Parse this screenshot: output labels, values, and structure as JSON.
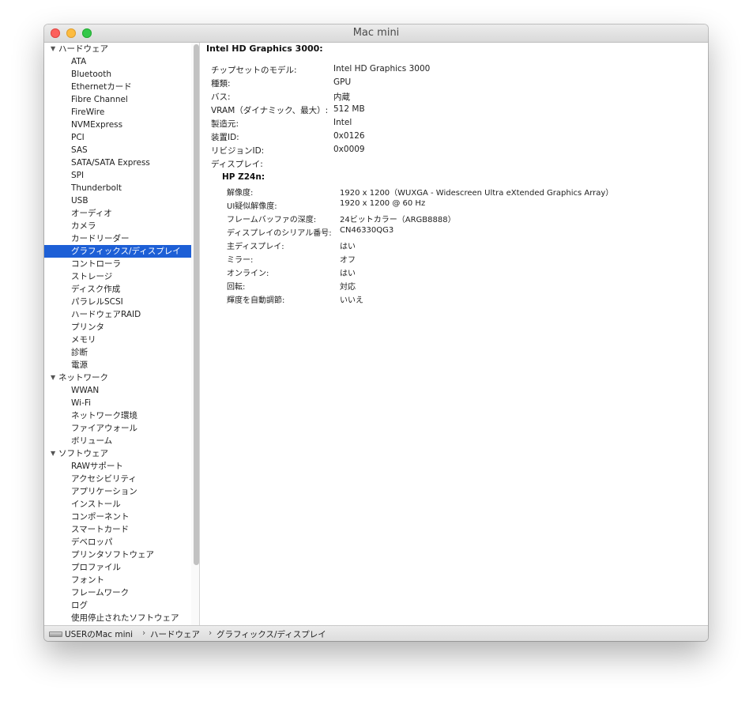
{
  "window": {
    "title": "Mac mini"
  },
  "sidebar": {
    "items": [
      {
        "label": "ハードウェア",
        "group": true
      },
      {
        "label": "ATA"
      },
      {
        "label": "Bluetooth"
      },
      {
        "label": "Ethernetカード"
      },
      {
        "label": "Fibre Channel"
      },
      {
        "label": "FireWire"
      },
      {
        "label": "NVMExpress"
      },
      {
        "label": "PCI"
      },
      {
        "label": "SAS"
      },
      {
        "label": "SATA/SATA Express"
      },
      {
        "label": "SPI"
      },
      {
        "label": "Thunderbolt"
      },
      {
        "label": "USB"
      },
      {
        "label": "オーディオ"
      },
      {
        "label": "カメラ"
      },
      {
        "label": "カードリーダー"
      },
      {
        "label": "グラフィックス/ディスプレイ",
        "selected": true
      },
      {
        "label": "コントローラ"
      },
      {
        "label": "ストレージ"
      },
      {
        "label": "ディスク作成"
      },
      {
        "label": "パラレルSCSI"
      },
      {
        "label": "ハードウェアRAID"
      },
      {
        "label": "プリンタ"
      },
      {
        "label": "メモリ"
      },
      {
        "label": "診断"
      },
      {
        "label": "電源"
      },
      {
        "label": "ネットワーク",
        "group": true
      },
      {
        "label": "WWAN"
      },
      {
        "label": "Wi-Fi"
      },
      {
        "label": "ネットワーク環境"
      },
      {
        "label": "ファイアウォール"
      },
      {
        "label": "ボリューム"
      },
      {
        "label": "ソフトウェア",
        "group": true
      },
      {
        "label": "RAWサポート"
      },
      {
        "label": "アクセシビリティ"
      },
      {
        "label": "アプリケーション"
      },
      {
        "label": "インストール"
      },
      {
        "label": "コンポーネント"
      },
      {
        "label": "スマートカード"
      },
      {
        "label": "デベロッパ"
      },
      {
        "label": "プリンタソフトウェア"
      },
      {
        "label": "プロファイル"
      },
      {
        "label": "フォント"
      },
      {
        "label": "フレームワーク"
      },
      {
        "label": "ログ"
      },
      {
        "label": "使用停止されたソフトウェア"
      }
    ]
  },
  "detail": {
    "heading": "Intel HD Graphics 3000:",
    "properties": [
      {
        "label": "チップセットのモデル:",
        "value": "Intel HD Graphics 3000"
      },
      {
        "label": "種類:",
        "value": "GPU"
      },
      {
        "label": "バス:",
        "value": "内蔵"
      },
      {
        "label": "VRAM（ダイナミック、最大）:",
        "value": "512 MB"
      },
      {
        "label": "製造元:",
        "value": "Intel"
      },
      {
        "label": "装置ID:",
        "value": "0x0126"
      },
      {
        "label": "リビジョンID:",
        "value": "0x0009"
      },
      {
        "label": "ディスプレイ:",
        "value": ""
      }
    ],
    "display": {
      "name": "HP Z24n:",
      "properties": [
        {
          "label": "解像度:",
          "value": "1920 x 1200（WUXGA - Widescreen Ultra eXtended Graphics Array）"
        },
        {
          "label": "UI疑似解像度:",
          "value": "1920 x 1200 @ 60 Hz"
        },
        {
          "label": "フレームバッファの深度:",
          "value": "24ビットカラー（ARGB8888）"
        },
        {
          "label": "ディスプレイのシリアル番号:",
          "value": "CN46330QG3"
        },
        {
          "label": "主ディスプレイ:",
          "value": "はい"
        },
        {
          "label": "ミラー:",
          "value": "オフ"
        },
        {
          "label": "オンライン:",
          "value": "はい"
        },
        {
          "label": "回転:",
          "value": "対応"
        },
        {
          "label": "輝度を自動調節:",
          "value": "いいえ"
        }
      ]
    }
  },
  "statusbar": {
    "crumbs": [
      "USERのMac mini",
      "ハードウェア",
      "グラフィックス/ディスプレイ"
    ]
  },
  "colors": {
    "selection": "#1d5fd6",
    "close": "#fc605c",
    "minimize": "#fdbc40",
    "maximize": "#34c84a"
  }
}
